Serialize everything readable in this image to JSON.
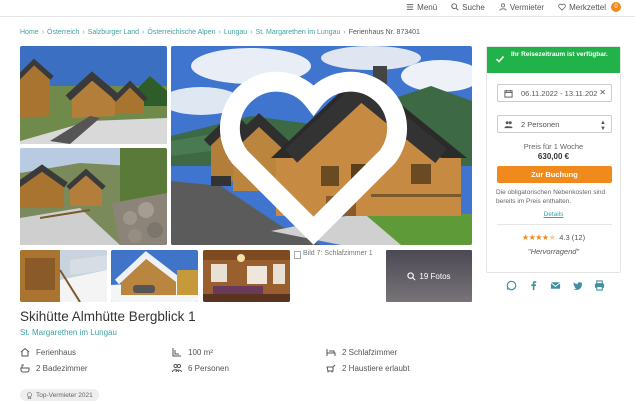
{
  "nav": {
    "menu_label": "Menü",
    "search_label": "Suche",
    "landlord_label": "Vermieter",
    "wishlist_label": "Merkzettel",
    "wishlist_count": "0"
  },
  "breadcrumbs": [
    "Home",
    "Österreich",
    "Salzburger Land",
    "Österreichische Alpen",
    "Lungau",
    "St. Margarethen im Lungau",
    "Ferienhaus Nr. 873401"
  ],
  "gallery": {
    "photo7_alt": "Bild 7: Schlafzimmer 1",
    "more_photos_label": "19 Fotos"
  },
  "listing": {
    "title": "Skihütte Almhütte Bergblick 1",
    "location": "St. Margarethen im Lungau",
    "facts": {
      "type": "Ferienhaus",
      "area": "100 m²",
      "bedrooms": "2 Schlafzimmer",
      "bathrooms": "2 Badezimmer",
      "persons": "6 Personen",
      "pets": "2 Haustiere erlaubt"
    },
    "top_badge": "Top-Vermieter 2021"
  },
  "booking": {
    "availability": "Ihr Reisezeitraum ist verfügbar.",
    "dates": "06.11.2022 - 13.11.202",
    "guests": "2 Personen",
    "price_label": "Preis für 1 Woche",
    "price": "630,00 €",
    "book_button": "Zur Buchung",
    "cost_note": "Die obligatorischen Nebenkosten sind bereits im Preis enthalten.",
    "details_link": "Details",
    "rating_stars": 4.3,
    "rating_text": "4.3 (12)",
    "verdict": "\"Hervorragend\""
  },
  "icons": [
    "menu-icon",
    "search-icon",
    "user-icon",
    "heart-icon",
    "calendar-icon",
    "close-icon",
    "people-icon",
    "caret-icon",
    "check-icon",
    "home-icon",
    "area-icon",
    "bed-icon",
    "bath-icon",
    "persons-icon",
    "pet-icon",
    "whatsapp-icon",
    "facebook-icon",
    "email-icon",
    "twitter-icon",
    "print-icon",
    "camera-icon",
    "award-icon"
  ],
  "colors": {
    "accent": "#3fa3a3",
    "book": "#f08a1c",
    "available": "#21b24a"
  }
}
